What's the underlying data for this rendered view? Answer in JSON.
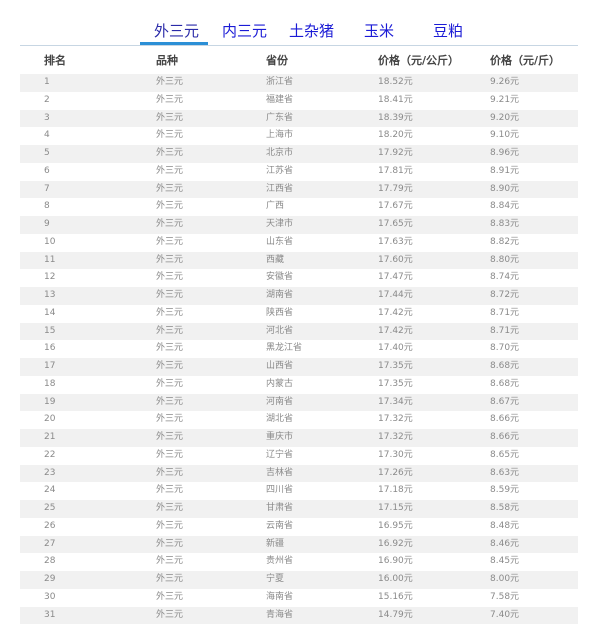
{
  "tabs": [
    {
      "label": "外三元",
      "active": true
    },
    {
      "label": "内三元",
      "active": false
    },
    {
      "label": "土杂猪",
      "active": false
    },
    {
      "label": "玉米",
      "active": false
    },
    {
      "label": "豆粕",
      "active": false
    }
  ],
  "table": {
    "headers": [
      "排名",
      "品种",
      "省份",
      "价格（元/公斤）",
      "价格（元/斤）"
    ],
    "rows": [
      {
        "rank": "1",
        "breed": "外三元",
        "province": "浙江省",
        "price_kg": "18.52元",
        "price_jin": "9.26元"
      },
      {
        "rank": "2",
        "breed": "外三元",
        "province": "福建省",
        "price_kg": "18.41元",
        "price_jin": "9.21元"
      },
      {
        "rank": "3",
        "breed": "外三元",
        "province": "广东省",
        "price_kg": "18.39元",
        "price_jin": "9.20元"
      },
      {
        "rank": "4",
        "breed": "外三元",
        "province": "上海市",
        "price_kg": "18.20元",
        "price_jin": "9.10元"
      },
      {
        "rank": "5",
        "breed": "外三元",
        "province": "北京市",
        "price_kg": "17.92元",
        "price_jin": "8.96元"
      },
      {
        "rank": "6",
        "breed": "外三元",
        "province": "江苏省",
        "price_kg": "17.81元",
        "price_jin": "8.91元"
      },
      {
        "rank": "7",
        "breed": "外三元",
        "province": "江西省",
        "price_kg": "17.79元",
        "price_jin": "8.90元"
      },
      {
        "rank": "8",
        "breed": "外三元",
        "province": "广西",
        "price_kg": "17.67元",
        "price_jin": "8.84元"
      },
      {
        "rank": "9",
        "breed": "外三元",
        "province": "天津市",
        "price_kg": "17.65元",
        "price_jin": "8.83元"
      },
      {
        "rank": "10",
        "breed": "外三元",
        "province": "山东省",
        "price_kg": "17.63元",
        "price_jin": "8.82元"
      },
      {
        "rank": "11",
        "breed": "外三元",
        "province": "西藏",
        "price_kg": "17.60元",
        "price_jin": "8.80元"
      },
      {
        "rank": "12",
        "breed": "外三元",
        "province": "安徽省",
        "price_kg": "17.47元",
        "price_jin": "8.74元"
      },
      {
        "rank": "13",
        "breed": "外三元",
        "province": "湖南省",
        "price_kg": "17.44元",
        "price_jin": "8.72元"
      },
      {
        "rank": "14",
        "breed": "外三元",
        "province": "陕西省",
        "price_kg": "17.42元",
        "price_jin": "8.71元"
      },
      {
        "rank": "15",
        "breed": "外三元",
        "province": "河北省",
        "price_kg": "17.42元",
        "price_jin": "8.71元"
      },
      {
        "rank": "16",
        "breed": "外三元",
        "province": "黑龙江省",
        "price_kg": "17.40元",
        "price_jin": "8.70元"
      },
      {
        "rank": "17",
        "breed": "外三元",
        "province": "山西省",
        "price_kg": "17.35元",
        "price_jin": "8.68元"
      },
      {
        "rank": "18",
        "breed": "外三元",
        "province": "内蒙古",
        "price_kg": "17.35元",
        "price_jin": "8.68元"
      },
      {
        "rank": "19",
        "breed": "外三元",
        "province": "河南省",
        "price_kg": "17.34元",
        "price_jin": "8.67元"
      },
      {
        "rank": "20",
        "breed": "外三元",
        "province": "湖北省",
        "price_kg": "17.32元",
        "price_jin": "8.66元"
      },
      {
        "rank": "21",
        "breed": "外三元",
        "province": "重庆市",
        "price_kg": "17.32元",
        "price_jin": "8.66元"
      },
      {
        "rank": "22",
        "breed": "外三元",
        "province": "辽宁省",
        "price_kg": "17.30元",
        "price_jin": "8.65元"
      },
      {
        "rank": "23",
        "breed": "外三元",
        "province": "吉林省",
        "price_kg": "17.26元",
        "price_jin": "8.63元"
      },
      {
        "rank": "24",
        "breed": "外三元",
        "province": "四川省",
        "price_kg": "17.18元",
        "price_jin": "8.59元"
      },
      {
        "rank": "25",
        "breed": "外三元",
        "province": "甘肃省",
        "price_kg": "17.15元",
        "price_jin": "8.58元"
      },
      {
        "rank": "26",
        "breed": "外三元",
        "province": "云南省",
        "price_kg": "16.95元",
        "price_jin": "8.48元"
      },
      {
        "rank": "27",
        "breed": "外三元",
        "province": "新疆",
        "price_kg": "16.92元",
        "price_jin": "8.46元"
      },
      {
        "rank": "28",
        "breed": "外三元",
        "province": "贵州省",
        "price_kg": "16.90元",
        "price_jin": "8.45元"
      },
      {
        "rank": "29",
        "breed": "外三元",
        "province": "宁夏",
        "price_kg": "16.00元",
        "price_jin": "8.00元"
      },
      {
        "rank": "30",
        "breed": "外三元",
        "province": "海南省",
        "price_kg": "15.16元",
        "price_jin": "7.58元"
      },
      {
        "rank": "31",
        "breed": "外三元",
        "province": "青海省",
        "price_kg": "14.79元",
        "price_jin": "7.40元"
      }
    ]
  },
  "colors": {
    "tab_text": "#1b1bd6",
    "tab_underline": "#2b8fd6",
    "row_stripe": "#f1f1f1"
  }
}
